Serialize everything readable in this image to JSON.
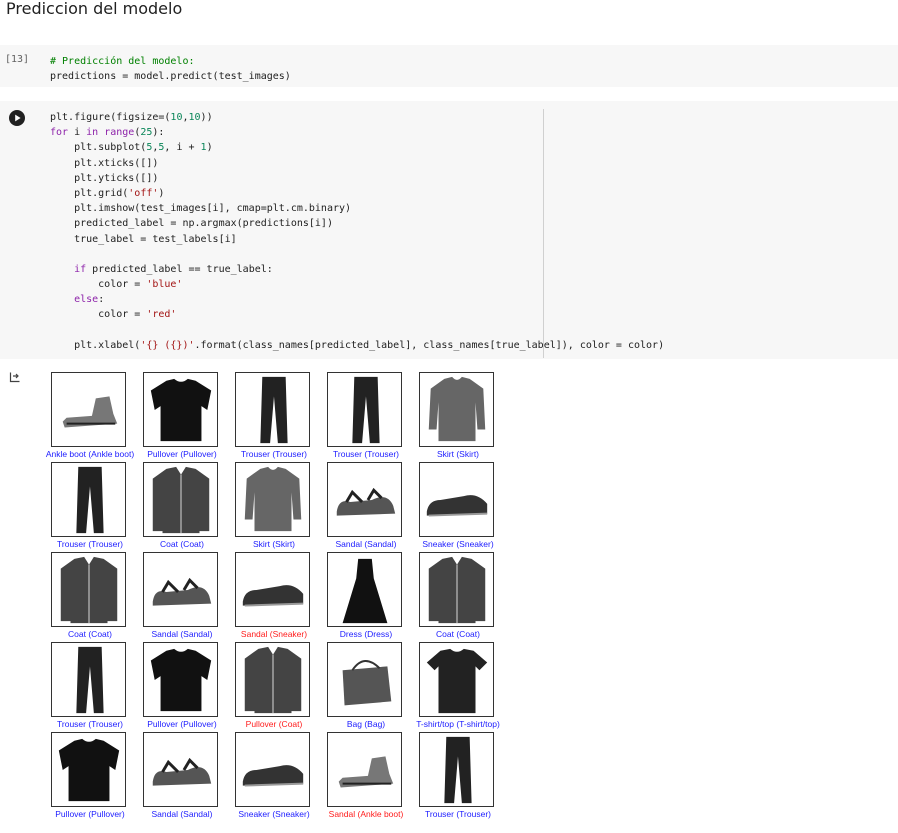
{
  "heading": "Prediccion del modelo",
  "cell1": {
    "exec_count": "[13]",
    "lines": [
      [
        {
          "t": "# Predicción del modelo:",
          "c": "comment"
        }
      ],
      [
        {
          "t": "predictions = model.predict(test_images)",
          "c": ""
        }
      ]
    ]
  },
  "cell2": {
    "run_icon": "play-icon",
    "lines": [
      [
        {
          "t": "plt.figure(figsize=(",
          "c": ""
        },
        {
          "t": "10",
          "c": "num"
        },
        {
          "t": ",",
          "c": ""
        },
        {
          "t": "10",
          "c": "num"
        },
        {
          "t": "))",
          "c": ""
        }
      ],
      [
        {
          "t": "for",
          "c": "kw"
        },
        {
          "t": " i ",
          "c": ""
        },
        {
          "t": "in",
          "c": "kw"
        },
        {
          "t": " ",
          "c": ""
        },
        {
          "t": "range",
          "c": "kw"
        },
        {
          "t": "(",
          "c": ""
        },
        {
          "t": "25",
          "c": "num"
        },
        {
          "t": "):",
          "c": ""
        }
      ],
      [
        {
          "t": "    plt.subplot(",
          "c": ""
        },
        {
          "t": "5",
          "c": "num"
        },
        {
          "t": ",",
          "c": ""
        },
        {
          "t": "5",
          "c": "num"
        },
        {
          "t": ", i + ",
          "c": ""
        },
        {
          "t": "1",
          "c": "num"
        },
        {
          "t": ")",
          "c": ""
        }
      ],
      [
        {
          "t": "    plt.xticks([])",
          "c": ""
        }
      ],
      [
        {
          "t": "    plt.yticks([])",
          "c": ""
        }
      ],
      [
        {
          "t": "    plt.grid(",
          "c": ""
        },
        {
          "t": "'off'",
          "c": "str"
        },
        {
          "t": ")",
          "c": ""
        }
      ],
      [
        {
          "t": "    plt.imshow(test_images[i], cmap=plt.cm.binary)",
          "c": ""
        }
      ],
      [
        {
          "t": "    predicted_label = np.argmax(predictions[i])",
          "c": ""
        }
      ],
      [
        {
          "t": "    true_label = test_labels[i]",
          "c": ""
        }
      ],
      [
        {
          "t": "",
          "c": ""
        }
      ],
      [
        {
          "t": "    ",
          "c": ""
        },
        {
          "t": "if",
          "c": "kw"
        },
        {
          "t": " predicted_label == true_label:",
          "c": ""
        }
      ],
      [
        {
          "t": "        color = ",
          "c": ""
        },
        {
          "t": "'blue'",
          "c": "str"
        }
      ],
      [
        {
          "t": "    ",
          "c": ""
        },
        {
          "t": "else",
          "c": "kw"
        },
        {
          "t": ":",
          "c": ""
        }
      ],
      [
        {
          "t": "        color = ",
          "c": ""
        },
        {
          "t": "'red'",
          "c": "str"
        }
      ],
      [
        {
          "t": "",
          "c": ""
        }
      ],
      [
        {
          "t": "    plt.xlabel(",
          "c": ""
        },
        {
          "t": "'{} ({})'",
          "c": "str"
        },
        {
          "t": ".format(class_names[predicted_label], class_names[true_label]), color = color)",
          "c": ""
        }
      ]
    ]
  },
  "output": {
    "icon": "output-arrow-icon",
    "colors": {
      "blue": "#1c1cff",
      "red": "#ff1c1c"
    },
    "tiles": [
      {
        "label": "Ankle boot (Ankle boot)",
        "correct": true,
        "icon": "ankle-boot"
      },
      {
        "label": "Pullover (Pullover)",
        "correct": true,
        "icon": "pullover"
      },
      {
        "label": "Trouser (Trouser)",
        "correct": true,
        "icon": "trouser"
      },
      {
        "label": "Trouser (Trouser)",
        "correct": true,
        "icon": "trouser"
      },
      {
        "label": "Skirt (Skirt)",
        "correct": true,
        "icon": "shirt"
      },
      {
        "label": "Trouser (Trouser)",
        "correct": true,
        "icon": "trouser"
      },
      {
        "label": "Coat (Coat)",
        "correct": true,
        "icon": "coat"
      },
      {
        "label": "Skirt (Skirt)",
        "correct": true,
        "icon": "shirt"
      },
      {
        "label": "Sandal (Sandal)",
        "correct": true,
        "icon": "sandal"
      },
      {
        "label": "Sneaker (Sneaker)",
        "correct": true,
        "icon": "sneaker"
      },
      {
        "label": "Coat (Coat)",
        "correct": true,
        "icon": "coat"
      },
      {
        "label": "Sandal (Sandal)",
        "correct": true,
        "icon": "sandal"
      },
      {
        "label": "Sandal (Sneaker)",
        "correct": false,
        "icon": "sneaker"
      },
      {
        "label": "Dress (Dress)",
        "correct": true,
        "icon": "dress"
      },
      {
        "label": "Coat (Coat)",
        "correct": true,
        "icon": "coat"
      },
      {
        "label": "Trouser (Trouser)",
        "correct": true,
        "icon": "trouser"
      },
      {
        "label": "Pullover (Pullover)",
        "correct": true,
        "icon": "pullover"
      },
      {
        "label": "Pullover (Coat)",
        "correct": false,
        "icon": "coat"
      },
      {
        "label": "Bag (Bag)",
        "correct": true,
        "icon": "bag"
      },
      {
        "label": "T-shirt/top (T-shirt/top)",
        "correct": true,
        "icon": "tshirt"
      },
      {
        "label": "Pullover (Pullover)",
        "correct": true,
        "icon": "pullover"
      },
      {
        "label": "Sandal (Sandal)",
        "correct": true,
        "icon": "sandal"
      },
      {
        "label": "Sneaker (Sneaker)",
        "correct": true,
        "icon": "sneaker"
      },
      {
        "label": "Sandal (Ankle boot)",
        "correct": false,
        "icon": "ankle-boot"
      },
      {
        "label": "Trouser (Trouser)",
        "correct": true,
        "icon": "trouser"
      }
    ]
  }
}
